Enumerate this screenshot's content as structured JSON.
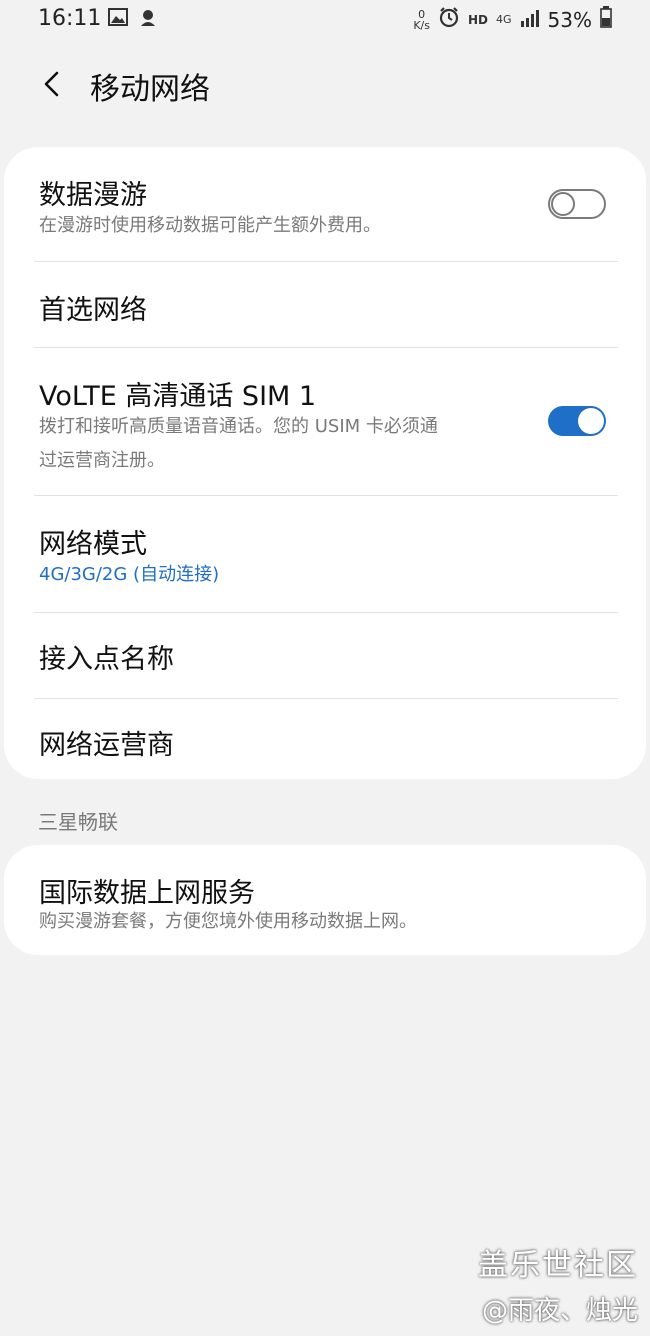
{
  "status_bar": {
    "time": "16:11",
    "net_speed_value": "0",
    "net_speed_unit": "K/s",
    "hd": "HD",
    "network_type": "4G",
    "battery": "53%"
  },
  "header": {
    "title": "移动网络"
  },
  "settings": [
    {
      "title": "数据漫游",
      "subtitle": "在漫游时使用移动数据可能产生额外费用。",
      "toggle": "off"
    },
    {
      "title": "首选网络"
    },
    {
      "title": "VoLTE 高清通话 SIM 1",
      "subtitle_line1": "拨打和接听高质量语音通话。您的 USIM 卡必须通",
      "subtitle_line2": "过运营商注册。",
      "toggle": "on"
    },
    {
      "title": "网络模式",
      "value": "4G/3G/2G (自动连接)"
    },
    {
      "title": "接入点名称"
    },
    {
      "title": "网络运营商"
    }
  ],
  "section": {
    "label": "三星畅联",
    "item": {
      "title": "国际数据上网服务",
      "subtitle": "购买漫游套餐，方便您境外使用移动数据上网。"
    }
  },
  "watermark": {
    "brand": "盖乐世社区",
    "author": "@雨夜、烛光"
  },
  "colors": {
    "accent": "#1f6fc8",
    "background": "#f2f2f2",
    "card": "#ffffff",
    "secondary_text": "#7a7a7a"
  }
}
